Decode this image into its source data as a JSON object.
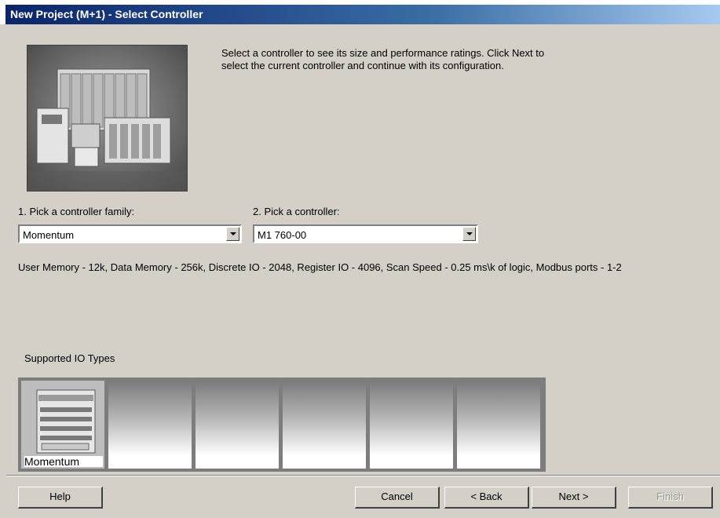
{
  "window": {
    "title": "New Project (M+1) - Select Controller"
  },
  "intro_text": "Select a controller to see its size and performance ratings. Click Next to select the current controller and continue with its configuration.",
  "family": {
    "label": "1. Pick a controller family:",
    "selected": "Momentum"
  },
  "controller": {
    "label": "2. Pick a controller:",
    "selected": "M1 760-00"
  },
  "specs_text": "User Memory - 12k, Data Memory - 256k, Discrete IO - 2048, Register IO - 4096, Scan Speed - 0.25 ms\\k of logic, Modbus ports - 1-2",
  "io_types": {
    "label": "Supported IO Types",
    "items": [
      {
        "label": "Momentum"
      },
      {
        "label": ""
      },
      {
        "label": ""
      },
      {
        "label": ""
      },
      {
        "label": ""
      },
      {
        "label": ""
      }
    ]
  },
  "buttons": {
    "help": "Help",
    "cancel": "Cancel",
    "back": "< Back",
    "next": "Next >",
    "finish": "Finish"
  },
  "colors": {
    "dialog_bg": "#d4d0c8",
    "titlebar_start": "#0a246a",
    "titlebar_end": "#a6caf0"
  },
  "icons": [
    "controller-photo",
    "momentum-module-icon",
    "dropdown-arrow-icon"
  ]
}
